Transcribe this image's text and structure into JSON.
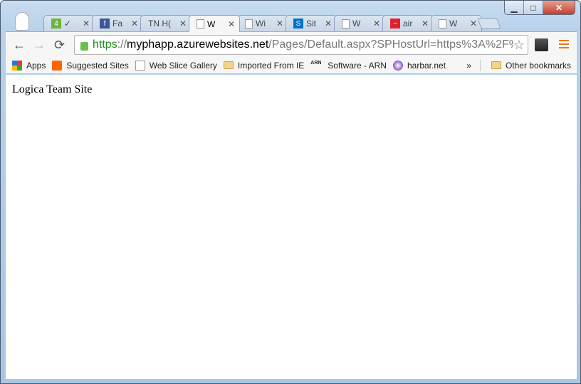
{
  "window": {
    "controls": {
      "minimize": "▁",
      "maximize": "□",
      "close": "✕"
    }
  },
  "tabs": [
    {
      "title": "✓",
      "icon": "4",
      "icon_color": "#6cb33f",
      "active": false
    },
    {
      "title": "Fa",
      "icon": "f",
      "icon_color": "#3b5998",
      "active": false
    },
    {
      "title": "TN H(",
      "icon": "",
      "icon_color": "",
      "active": false
    },
    {
      "title": "W",
      "icon": "page",
      "icon_color": "",
      "active": true
    },
    {
      "title": "Wi",
      "icon": "page",
      "icon_color": "",
      "active": false
    },
    {
      "title": "Sit",
      "icon": "S",
      "icon_color": "#0072c6",
      "active": false
    },
    {
      "title": "W",
      "icon": "page",
      "icon_color": "",
      "active": false
    },
    {
      "title": "air",
      "icon": "~",
      "icon_color": "#e02030",
      "active": false
    },
    {
      "title": "W",
      "icon": "page",
      "icon_color": "",
      "active": false
    }
  ],
  "toolbar": {
    "back": "←",
    "forward": "→",
    "reload": "⟳",
    "star": "☆",
    "url": {
      "scheme": "https",
      "sep": "://",
      "host": "myphapp.azurewebsites.net",
      "path": "/Pages/Default.aspx?SPHostUrl=https%3A%2F%2"
    }
  },
  "bookmarks": {
    "items": [
      {
        "label": "Apps",
        "icon": "apps"
      },
      {
        "label": "Suggested Sites",
        "icon": "bulb"
      },
      {
        "label": "Web Slice Gallery",
        "icon": "page"
      },
      {
        "label": "Imported From IE",
        "icon": "folder"
      },
      {
        "label": "Software - ARN",
        "icon": "ARN"
      },
      {
        "label": "harbar.net",
        "icon": "orb"
      }
    ],
    "overflow": "»",
    "other": "Other bookmarks"
  },
  "content": {
    "title": "Logica Team Site"
  }
}
